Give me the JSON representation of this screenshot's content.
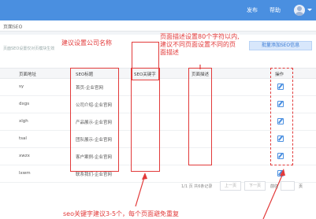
{
  "topbar": {
    "nav": [
      "发布",
      "帮助"
    ],
    "avatar_icon": "user-avatar-icon"
  },
  "breadcrumb": "页面SEO",
  "hint": "页面SEO设置仅对页模块生效",
  "add_button": "批量添加SEO信息",
  "table": {
    "headers": [
      "页面地址",
      "SEO标题",
      "SEO关键字",
      "页面描述",
      "操作"
    ],
    "rows": [
      {
        "addr": "sy",
        "title": "首页-企业官网",
        "keywords": "",
        "desc": ""
      },
      {
        "addr": "dxgs",
        "title": "公司介绍-企业官网",
        "keywords": "",
        "desc": ""
      },
      {
        "addr": "xlgh",
        "title": "产品展示-企业官网",
        "keywords": "",
        "desc": ""
      },
      {
        "addr": "tsal",
        "title": "团队展示-企业官网",
        "keywords": "",
        "desc": ""
      },
      {
        "addr": "xwzx",
        "title": "客户案例-企业官网",
        "keywords": "",
        "desc": ""
      },
      {
        "addr": "lxwm",
        "title": "联系我们-企业官网",
        "keywords": "",
        "desc": ""
      }
    ],
    "edit_icon": "edit-icon"
  },
  "pager": {
    "info": "1/1 页 共6条记录",
    "prev": "上一页",
    "next": "下一页",
    "goto": "前往",
    "unit": "页"
  },
  "annotations": {
    "company": "建议设置公司名称",
    "desc_line1": "页面描述设置80个字符以内,",
    "desc_line2": "建议不同页面设置不同的页",
    "desc_line3": "面描述",
    "keywords": "seo关键字建议3-5个，每个页面避免重复"
  },
  "colors": {
    "topbar": "#4a8fe0",
    "annotation": "#e23a3a"
  }
}
